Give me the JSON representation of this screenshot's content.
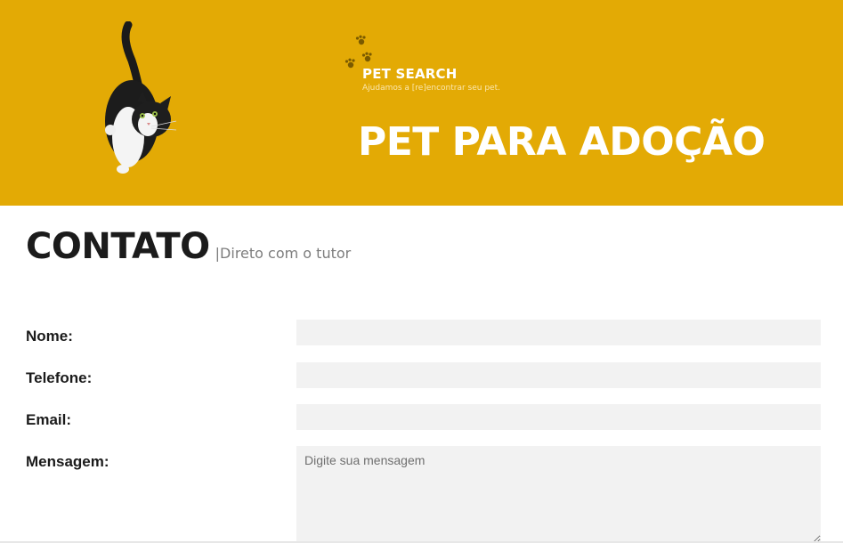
{
  "hero": {
    "background_color": "#e3aa05",
    "cat_image": "cat-photo",
    "paw_icon": "paw-prints-icon",
    "brand_name": "PET SEARCH",
    "brand_tagline": "Ajudamos a [re]encontrar seu pet.",
    "title": "PET PARA ADOÇÃO"
  },
  "contact": {
    "title": "CONTATO",
    "subtitle": "|Direto com o tutor"
  },
  "form": {
    "name_label": "Nome:",
    "name_value": "",
    "phone_label": "Telefone:",
    "phone_value": "",
    "email_label": "Email:",
    "email_value": "",
    "message_label": "Mensagem:",
    "message_placeholder": "Digite sua mensagem"
  }
}
